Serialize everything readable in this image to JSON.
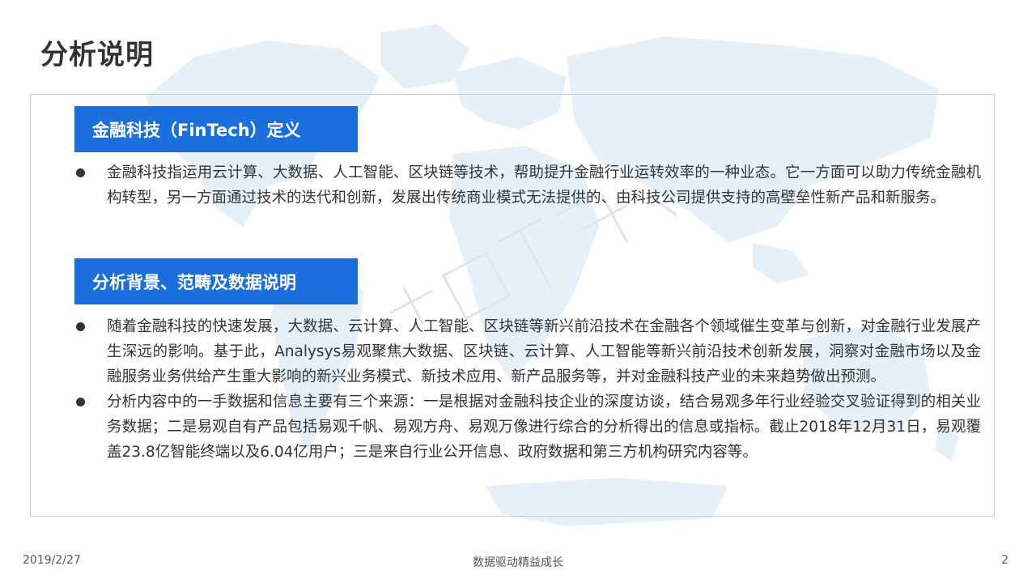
{
  "page": {
    "title": "分析说明"
  },
  "sections": [
    {
      "heading": "金融科技（FinTech）定义",
      "bullets": [
        "金融科技指运用云计算、大数据、人工智能、区块链等技术，帮助提升金融行业运转效率的一种业态。它一方面可以助力传统金融机构转型，另一方面通过技术的迭代和创新，发展出传统商业模式无法提供的、由科技公司提供支持的高壁垒性新产品和新服务。"
      ]
    },
    {
      "heading": "分析背景、范畴及数据说明",
      "bullets": [
        "随着金融科技的快速发展，大数据、云计算、人工智能、区块链等新兴前沿技术在金融各个领域催生变革与创新，对金融行业发展产生深远的影响。基于此，Analysys易观聚焦大数据、区块链、云计算、人工智能等新兴前沿技术创新发展，洞察对金融市场以及金融服务业务供给产生重大影响的新兴业务模式、新技术应用、新产品服务等，并对金融科技产业的未来趋势做出预测。",
        "分析内容中的一手数据和信息主要有三个来源：一是根据对金融科技企业的深度访谈，结合易观多年行业经验交叉验证得到的相关业务数据；二是易观自有产品包括易观千帆、易观方舟、易观万像进行综合的分析得出的信息或指标。截止2018年12月31日，易观覆盖23.8亿智能终端以及6.04亿用户；三是来自行业公开信息、政府数据和第三方机构研究内容等。"
      ]
    }
  ],
  "footer": {
    "date": "2019/2/27",
    "slogan": "数据驱动精益成长",
    "page_number": "2"
  },
  "colors": {
    "accent": "#1a6fdc",
    "map": "#e3eef8",
    "text": "#333333"
  }
}
